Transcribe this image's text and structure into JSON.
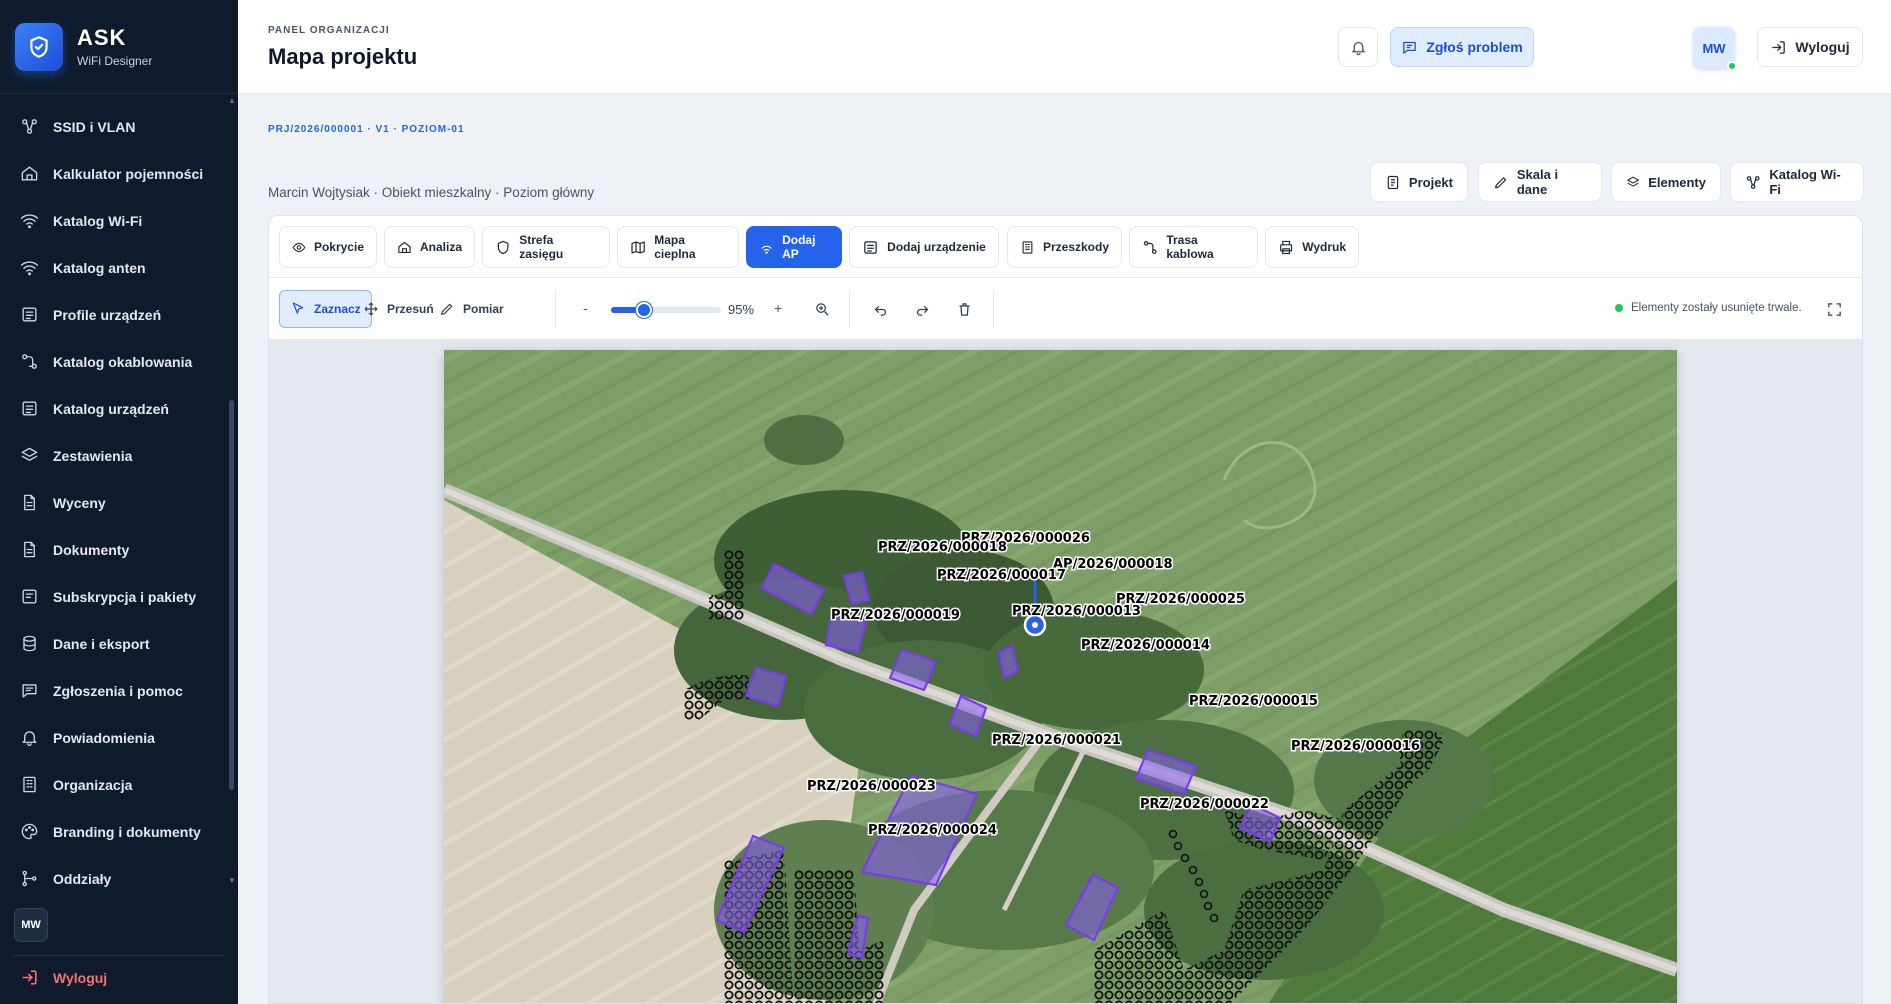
{
  "brand": {
    "title": "ASK",
    "subtitle": "WiFi Designer"
  },
  "sidebar": {
    "items": [
      {
        "label": "SSID i VLAN",
        "icon": "network-icon"
      },
      {
        "label": "Kalkulator pojemności",
        "icon": "home-icon"
      },
      {
        "label": "Katalog Wi-Fi",
        "icon": "wifi-icon"
      },
      {
        "label": "Katalog anten",
        "icon": "wifi-icon"
      },
      {
        "label": "Profile urządzeń",
        "icon": "list-icon"
      },
      {
        "label": "Katalog okablowania",
        "icon": "cable-icon"
      },
      {
        "label": "Katalog urządzeń",
        "icon": "list-icon"
      },
      {
        "label": "Zestawienia",
        "icon": "layers-icon"
      },
      {
        "label": "Wyceny",
        "icon": "file-icon"
      },
      {
        "label": "Dokumenty",
        "icon": "file-icon"
      },
      {
        "label": "Subskrypcja i pakiety",
        "icon": "receipt-icon"
      },
      {
        "label": "Dane i eksport",
        "icon": "database-icon"
      },
      {
        "label": "Zgłoszenia i pomoc",
        "icon": "chat-icon"
      },
      {
        "label": "Powiadomienia",
        "icon": "bell-icon"
      },
      {
        "label": "Organizacja",
        "icon": "building-icon"
      },
      {
        "label": "Branding i dokumenty",
        "icon": "palette-icon"
      },
      {
        "label": "Oddziały",
        "icon": "branch-icon"
      }
    ],
    "user_initials": "MW",
    "logout_label": "Wyloguj"
  },
  "header": {
    "crumb": "PANEL ORGANIZACJI",
    "title": "Mapa projektu",
    "report_label": "Zgłoś problem",
    "avatar_initials": "MW",
    "logout_label": "Wyloguj"
  },
  "project": {
    "code": "PRJ/2026/000001 · V1 · POZIOM-01",
    "description": "Marcin Wojtysiak · Obiekt mieszkalny · Poziom główny",
    "buttons": [
      "Projekt",
      "Skala i dane",
      "Elementy",
      "Katalog Wi-Fi"
    ]
  },
  "tabs": [
    "Pokrycie",
    "Analiza",
    "Strefa zasięgu",
    "Mapa cieplna",
    "Dodaj AP",
    "Dodaj urządzenie",
    "Przeszkody",
    "Trasa kablowa",
    "Wydruk"
  ],
  "active_tab": "Dodaj AP",
  "tools": {
    "select": "Zaznacz",
    "move": "Przesuń",
    "measure": "Pomiar",
    "minus": "-",
    "plus": "+",
    "zoom": "95%",
    "zoom_fraction": 0.3
  },
  "status": {
    "text": "Elementy zostały usunięte trwale.",
    "color": "#22c55e"
  },
  "map": {
    "labels": [
      "PRZ/2026/000026",
      "PRZ/2026/000018",
      "AP/2026/000018",
      "PRZ/2026/000017",
      "PRZ/2026/000025",
      "PRZ/2026/000019",
      "PRZ/2026/000013",
      "PRZ/2026/000014",
      "PRZ/2026/000015",
      "PRZ/2026/000016",
      "PRZ/2026/000021",
      "PRZ/2026/000023",
      "PRZ/2026/000022",
      "PRZ/2026/000024"
    ],
    "accent": "#2563eb",
    "obstacle_color": "#7c3aed"
  }
}
